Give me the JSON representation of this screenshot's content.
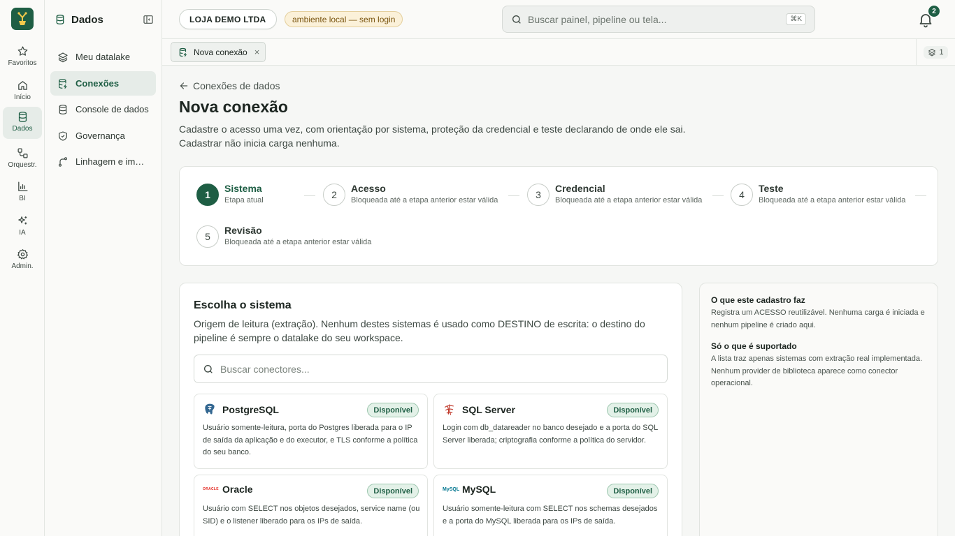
{
  "rail": {
    "items": [
      {
        "label": "Favoritos",
        "icon": "star-icon"
      },
      {
        "label": "Início",
        "icon": "home-icon"
      },
      {
        "label": "Dados",
        "icon": "database-icon"
      },
      {
        "label": "Orquestr.",
        "icon": "workflow-icon"
      },
      {
        "label": "BI",
        "icon": "bar-chart-icon"
      },
      {
        "label": "IA",
        "icon": "sparkles-icon"
      },
      {
        "label": "Admin.",
        "icon": "gear-icon"
      }
    ]
  },
  "sidebar": {
    "title": "Dados",
    "items": [
      {
        "label": "Meu datalake",
        "icon": "layers-icon"
      },
      {
        "label": "Conexões",
        "icon": "database-plug-icon"
      },
      {
        "label": "Console de dados",
        "icon": "database-icon"
      },
      {
        "label": "Governança",
        "icon": "shield-check-icon"
      },
      {
        "label": "Linhagem e impacto",
        "icon": "branch-icon"
      }
    ]
  },
  "topbar": {
    "org": "LOJA DEMO LTDA",
    "env": "ambiente local — sem login",
    "search_placeholder": "Buscar painel, pipeline ou tela...",
    "shortcut": "⌘K",
    "notifications": "2"
  },
  "tabs": {
    "open": [
      {
        "label": "Nova conexão",
        "close": "×"
      }
    ],
    "count": "1"
  },
  "page": {
    "back": "Conexões de dados",
    "title": "Nova conexão",
    "desc_line1": "Cadastre o acesso uma vez, com orientação por sistema, proteção da credencial e teste declarando de onde ele sai.",
    "desc_line2": "Cadastrar não inicia carga nenhuma."
  },
  "steps": [
    {
      "num": "1",
      "title": "Sistema",
      "sub": "Etapa atual",
      "active": true
    },
    {
      "num": "2",
      "title": "Acesso",
      "sub": "Bloqueada até a etapa anterior estar válida"
    },
    {
      "num": "3",
      "title": "Credencial",
      "sub": "Bloqueada até a etapa anterior estar válida"
    },
    {
      "num": "4",
      "title": "Teste",
      "sub": "Bloqueada até a etapa anterior estar válida"
    },
    {
      "num": "5",
      "title": "Revisão",
      "sub": "Bloqueada até a etapa anterior estar válida"
    }
  ],
  "system": {
    "title": "Escolha o sistema",
    "desc": "Origem de leitura (extração). Nenhum destes sistemas é usado como DESTINO de escrita: o destino do pipeline é sempre o datalake do seu workspace.",
    "search_placeholder": "Buscar conectores...",
    "connectors": [
      {
        "name": "PostgreSQL",
        "badge": "Disponível",
        "icon": "postgresql-icon",
        "desc": "Usuário somente-leitura, porta do Postgres liberada para o IP de saída da aplicação e do executor, e TLS conforme a política do seu banco."
      },
      {
        "name": "SQL Server",
        "badge": "Disponível",
        "icon": "sql-server-icon",
        "desc": "Login com db_datareader no banco desejado e a porta do SQL Server liberada; criptografia conforme a política do servidor."
      },
      {
        "name": "Oracle",
        "badge": "Disponível",
        "icon": "oracle-icon",
        "logo_text": "ORACLE",
        "desc": "Usuário com SELECT nos objetos desejados, service name (ou SID) e o listener liberado para os IPs de saída."
      },
      {
        "name": "MySQL",
        "badge": "Disponível",
        "icon": "mysql-icon",
        "logo_text": "MySQL",
        "desc": "Usuário somente-leitura com SELECT nos schemas desejados e a porta do MySQL liberada para os IPs de saída."
      }
    ]
  },
  "info": {
    "h1": "O que este cadastro faz",
    "p1": "Registra um ACESSO reutilizável. Nenhuma carga é iniciada e nenhum pipeline é criado aqui.",
    "h2": "Só o que é suportado",
    "p2": "A lista traz apenas sistemas com extração real implementada. Nenhum provider de biblioteca aparece como conector operacional."
  },
  "colors": {
    "accent": "#1e5e44",
    "env_bg": "#fbf1d9",
    "badge_bg": "#e3f1e8"
  }
}
